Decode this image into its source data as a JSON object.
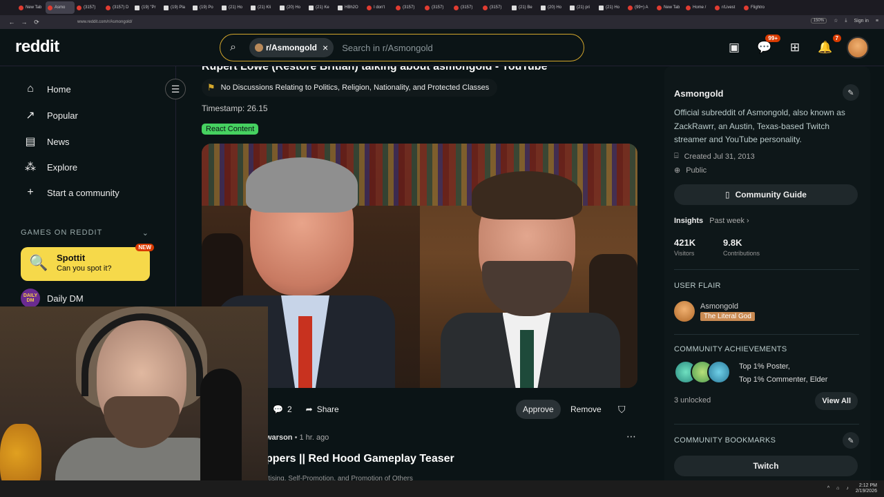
{
  "browser": {
    "tabs": [
      {
        "label": "New Tab"
      },
      {
        "label": "Asmo"
      },
      {
        "label": "(3157)"
      },
      {
        "label": "(3157) D"
      },
      {
        "label": "(19) \"Pr"
      },
      {
        "label": "(19) Pla"
      },
      {
        "label": "(19) Po"
      },
      {
        "label": "(21) Ho"
      },
      {
        "label": "(21) Kli"
      },
      {
        "label": "(20) Ho"
      },
      {
        "label": "(21) Ke"
      },
      {
        "label": "HBh2O"
      },
      {
        "label": "I don't"
      },
      {
        "label": "(3157)"
      },
      {
        "label": "(3157)"
      },
      {
        "label": "(3157)"
      },
      {
        "label": "(3157)"
      },
      {
        "label": "(21) Be"
      },
      {
        "label": "(20) Ho"
      },
      {
        "label": "(21) pri"
      },
      {
        "label": "(21) Ho"
      },
      {
        "label": "(99+) A"
      },
      {
        "label": "New Tab"
      },
      {
        "label": "Home /"
      },
      {
        "label": "r/Livest"
      },
      {
        "label": "Flightro"
      }
    ],
    "url": "www.reddit.com/r/Asmongold/",
    "zoom": "150%",
    "sign_in": "Sign in"
  },
  "header": {
    "logo": "reddit",
    "search_chip": "r/Asmongold",
    "search_placeholder": "Search in r/Asmongold",
    "chat_badge": "99+",
    "notif_badge": "7"
  },
  "sidebar": {
    "items": [
      {
        "label": "Home",
        "icon": "home-icon"
      },
      {
        "label": "Popular",
        "icon": "popular-icon"
      },
      {
        "label": "News",
        "icon": "news-icon"
      },
      {
        "label": "Explore",
        "icon": "explore-icon"
      },
      {
        "label": "Start a community",
        "icon": "plus-icon"
      }
    ],
    "games_header": "GAMES ON REDDIT",
    "game": {
      "title": "Spottit",
      "subtitle": "Can you spot it?",
      "badge": "NEW"
    },
    "daily": {
      "label": "Daily DM",
      "icon_text": "DAILY DM"
    }
  },
  "post": {
    "title": "Rupert Lowe (Restore Britian) talking about asmongold - YouTube",
    "rule": "No Discussions Relating to Politics, Religion, Nationality, and Protected Classes",
    "timestamp": "Timestamp: 26.15",
    "flair": "React Content",
    "comments": "2",
    "share": "Share",
    "approve": "Approve",
    "remove": "Remove"
  },
  "post2": {
    "author": "warson",
    "time": "• 1 hr. ago",
    "title": "ppers || Red Hood Gameplay Teaser",
    "rule": "rtising, Self-Promotion, and Promotion of Others"
  },
  "community": {
    "name": "Asmongold",
    "description": "Official subreddit of Asmongold, also known as ZackRawrr, an Austin, Texas-based Twitch streamer and YouTube personality.",
    "created": "Created Jul 31, 2013",
    "visibility": "Public",
    "guide_button": "Community Guide",
    "insights": "Insights",
    "insights_period": "Past week ›",
    "visitors_value": "421K",
    "visitors_label": "Visitors",
    "contrib_value": "9.8K",
    "contrib_label": "Contributions",
    "user_flair_header": "USER FLAIR",
    "flair_name": "Asmongold",
    "flair_tag": "The Literal God",
    "achievements_header": "COMMUNITY ACHIEVEMENTS",
    "achievement_1": "Top 1% Poster,",
    "achievement_2": "Top 1% Commenter, Elder",
    "unlocked": "3 unlocked",
    "view_all": "View All",
    "bookmarks_header": "COMMUNITY BOOKMARKS",
    "bookmark_1": "Twitch"
  },
  "taskbar": {
    "time": "2:12 PM",
    "date": "2/19/2026"
  }
}
